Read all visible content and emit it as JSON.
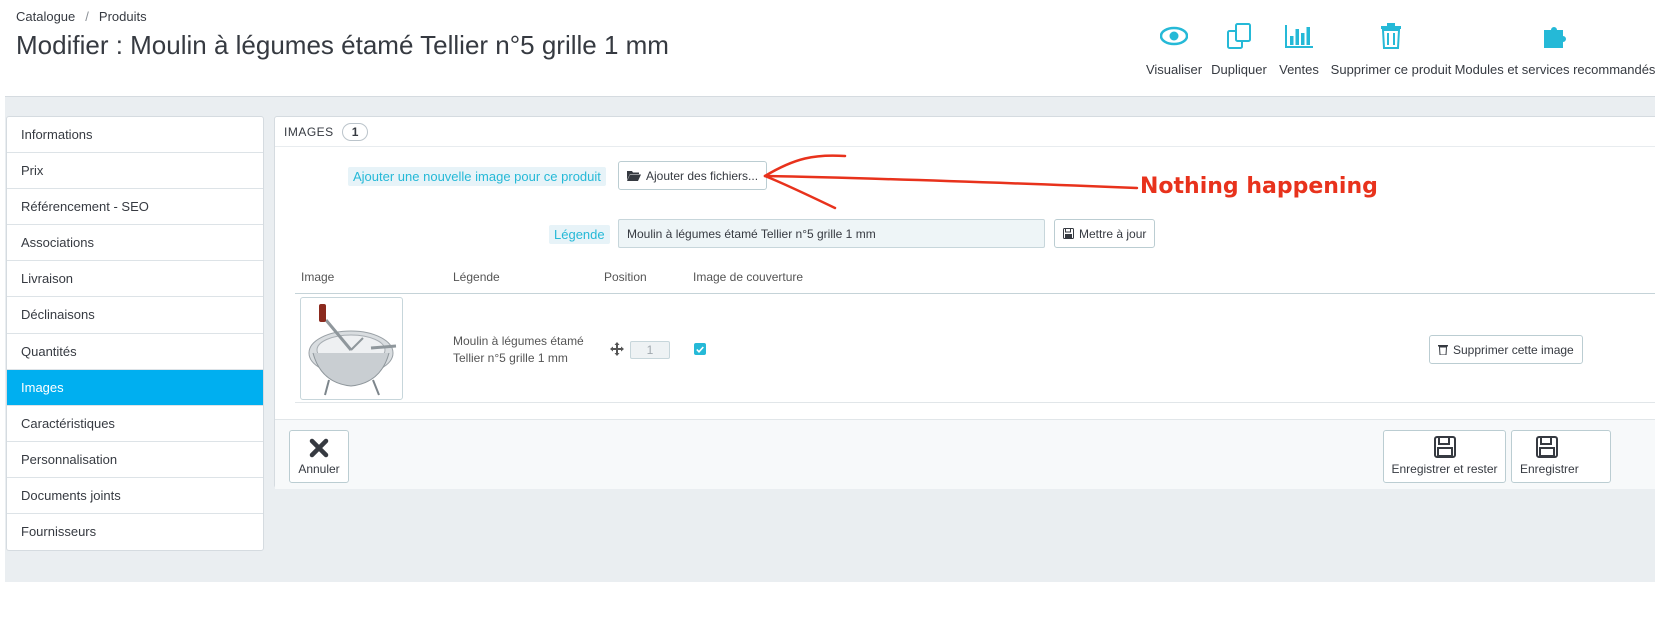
{
  "breadcrumb": {
    "items": [
      "Catalogue",
      "Produits"
    ],
    "separator": "/"
  },
  "page_title": "Modifier : Moulin à légumes étamé Tellier n°5 grille 1 mm",
  "toolbar": {
    "buttons": [
      {
        "label": "Visualiser",
        "icon": "eye-icon"
      },
      {
        "label": "Dupliquer",
        "icon": "copy-icon"
      },
      {
        "label": "Ventes",
        "icon": "bar-chart-icon"
      },
      {
        "label": "Supprimer ce produit",
        "icon": "trash-icon"
      },
      {
        "label": "Modules et services recommandés",
        "icon": "puzzle-icon"
      }
    ]
  },
  "sidebar": {
    "items": [
      {
        "label": "Informations"
      },
      {
        "label": "Prix"
      },
      {
        "label": "Référencement - SEO"
      },
      {
        "label": "Associations"
      },
      {
        "label": "Livraison"
      },
      {
        "label": "Déclinaisons"
      },
      {
        "label": "Quantités"
      },
      {
        "label": "Images",
        "active": true
      },
      {
        "label": "Caractéristiques"
      },
      {
        "label": "Personnalisation"
      },
      {
        "label": "Documents joints"
      },
      {
        "label": "Fournisseurs"
      }
    ]
  },
  "panel": {
    "title": "Images",
    "count": "1",
    "add_image_label": "Ajouter une nouvelle image pour ce produit",
    "add_files_button": "Ajouter des fichiers...",
    "legend_label": "Légende",
    "legend_value": "Moulin à légumes étamé Tellier n°5 grille 1 mm",
    "update_button": "Mettre à jour",
    "table": {
      "headers": [
        "Image",
        "Légende",
        "Position",
        "Image de couverture"
      ],
      "rows": [
        {
          "legend": "Moulin à légumes étamé Tellier n°5 grille 1 mm",
          "position": "1",
          "cover": true,
          "delete_label": "Supprimer cette image"
        }
      ]
    },
    "footer": {
      "cancel": "Annuler",
      "save_stay": "Enregistrer et rester",
      "save": "Enregistrer"
    }
  },
  "annotation": {
    "text": "Nothing happening",
    "color": "#e8321c"
  },
  "colors": {
    "accent": "#25b9d7",
    "active_nav": "#00aff0"
  }
}
